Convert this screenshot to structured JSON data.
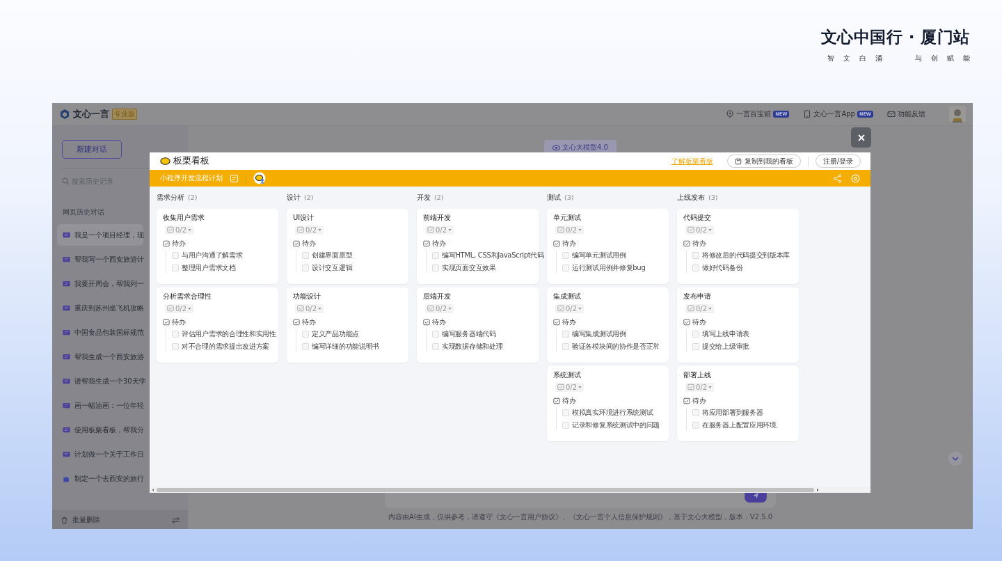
{
  "page_title": "文心中国行 · 厦门站",
  "page_subtitle": [
    "智",
    "文",
    "白",
    "涌",
    "与",
    "创",
    "赋",
    "能"
  ],
  "app": {
    "brand": "文心一言",
    "edition": "专业版",
    "header_links": [
      {
        "label": "一言百宝箱",
        "badge": "NEW",
        "kind": "box"
      },
      {
        "label": "文心一言App",
        "badge": "NEW",
        "kind": "phone"
      },
      {
        "label": "功能反馈",
        "kind": "mail"
      }
    ]
  },
  "sidebar": {
    "new_chat": "新建对话",
    "search": {
      "placeholder": "搜索历史记录"
    },
    "section": "网页历史对话",
    "items": [
      {
        "label": "我是一个项目经理，现",
        "kind": "chat",
        "selected": true
      },
      {
        "label": "帮我写一个西安旅游计",
        "kind": "chat",
        "selected": false
      },
      {
        "label": "我要开周会，帮我列一",
        "kind": "chat",
        "selected": false
      },
      {
        "label": "重庆到苏州坐飞机攻略",
        "kind": "chat",
        "selected": false
      },
      {
        "label": "中国食品包装国标规范",
        "kind": "chat",
        "selected": false
      },
      {
        "label": "帮我生成一个西安旅游",
        "kind": "chat",
        "selected": false
      },
      {
        "label": "请帮我生成一个30天学",
        "kind": "chat",
        "selected": false
      },
      {
        "label": "画一幅油画：一位年轻",
        "kind": "chat",
        "selected": false
      },
      {
        "label": "使用板栗看板，帮我分",
        "kind": "chat",
        "selected": false
      },
      {
        "label": "计划做一个关于工作日",
        "kind": "chat",
        "selected": false
      },
      {
        "label": "制定一个去西安的旅行",
        "kind": "plugin",
        "selected": false
      }
    ],
    "footer": "批量删除"
  },
  "main": {
    "model": "文心大模型4.0",
    "disclaimer": "内容由AI生成，仅供参考，请遵守《文心一言用户协议》、《文心一言个人信息保护规则》，基于文心大模型，版本：V2.5.0"
  },
  "modal": {
    "title": "板栗看板",
    "learn_link": "了解板栗看板",
    "copy_button": "复制到我的看板",
    "login_button": "注册/登录",
    "board_name": "小程序开发流程计划",
    "columns": [
      {
        "name": "需求分析",
        "count": "(2)",
        "cards": [
          {
            "title": "收集用户需求",
            "progress": "0/2",
            "level": 0,
            "group": "待办",
            "tasks": [
              {
                "label": "与用户沟通了解需求",
                "checked": false
              },
              {
                "label": "整理用户需求文档",
                "checked": false
              }
            ]
          },
          {
            "title": "分析需求合理性",
            "progress": "0/2",
            "level": 0,
            "group": "待办",
            "tasks": [
              {
                "label": "评估用户需求的合理性和实用性",
                "checked": false
              },
              {
                "label": "对不合理的需求提出改进方案",
                "checked": false
              }
            ]
          }
        ]
      },
      {
        "name": "设计",
        "count": "(2)",
        "cards": [
          {
            "title": "UI设计",
            "progress": "0/2",
            "level": 0,
            "group": "待办",
            "tasks": [
              {
                "label": "创建界面原型",
                "checked": false
              },
              {
                "label": "设计交互逻辑",
                "checked": false
              }
            ]
          },
          {
            "title": "功能设计",
            "progress": "0/2",
            "level": 0,
            "group": "待办",
            "tasks": [
              {
                "label": "定义产品功能点",
                "checked": false
              },
              {
                "label": "编写详细的功能说明书",
                "checked": false
              }
            ]
          }
        ]
      },
      {
        "name": "开发",
        "count": "(2)",
        "cards": [
          {
            "title": "前端开发",
            "progress": "0/2",
            "level": 0,
            "group": "待办",
            "tasks": [
              {
                "label": "编写HTML, CSS和JavaScript代码",
                "checked": false
              },
              {
                "label": "实现页面交互效果",
                "checked": false
              }
            ]
          },
          {
            "title": "后端开发",
            "progress": "0/2",
            "level": 0,
            "group": "待办",
            "tasks": [
              {
                "label": "编写服务器端代码",
                "checked": false
              },
              {
                "label": "实现数据存储和处理",
                "checked": false
              }
            ]
          }
        ]
      },
      {
        "name": "测试",
        "count": "(3)",
        "cards": [
          {
            "title": "单元测试",
            "progress": "0/2",
            "level": 0,
            "group": "待办",
            "tasks": [
              {
                "label": "编写单元测试用例",
                "checked": false
              },
              {
                "label": "运行测试用例并修复bug",
                "checked": false
              }
            ]
          },
          {
            "title": "集成测试",
            "progress": "0/2",
            "level": 0,
            "group": "待办",
            "tasks": [
              {
                "label": "编写集成测试用例",
                "checked": false
              },
              {
                "label": "验证各模块间的协作是否正常",
                "checked": false
              }
            ]
          },
          {
            "title": "系统测试",
            "progress": "0/2",
            "level": 0,
            "group": "待办",
            "tasks": [
              {
                "label": "模拟真实环境进行系统测试",
                "checked": false
              },
              {
                "label": "记录和修复系统测试中的问题",
                "checked": false
              }
            ]
          }
        ]
      },
      {
        "name": "上线发布",
        "count": "(3)",
        "cards": [
          {
            "title": "代码提交",
            "progress": "0/2",
            "level": 0,
            "group": "待办",
            "tasks": [
              {
                "label": "将修改后的代码提交到版本库",
                "checked": false
              },
              {
                "label": "做好代码备份",
                "checked": false
              }
            ]
          },
          {
            "title": "发布申请",
            "progress": "0/2",
            "level": 0,
            "group": "待办",
            "tasks": [
              {
                "label": "填写上线申请表",
                "checked": false
              },
              {
                "label": "提交给上级审批",
                "checked": false
              }
            ]
          },
          {
            "title": "部署上线",
            "progress": "0/2",
            "level": 0,
            "group": "待办",
            "tasks": [
              {
                "label": "将应用部署到服务器",
                "checked": false
              },
              {
                "label": "在服务器上配置应用环境",
                "checked": false
              }
            ]
          }
        ]
      }
    ]
  }
}
